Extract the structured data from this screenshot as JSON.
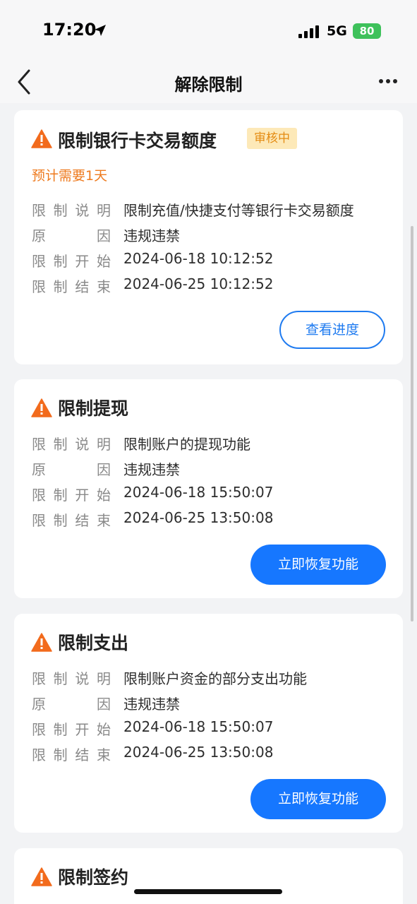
{
  "status": {
    "time": "17:20",
    "network": "5G",
    "battery": "80"
  },
  "nav": {
    "title": "解除限制"
  },
  "cards": [
    {
      "title": "限制银行卡交易额度",
      "badge": "审核中",
      "eta": "预计需要1天",
      "rows": [
        {
          "label": [
            "限",
            "制",
            "说",
            "明"
          ],
          "value": "限制充值/快捷支付等银行卡交易额度"
        },
        {
          "label": [
            "原",
            "因"
          ],
          "value": "违规违禁"
        },
        {
          "label": [
            "限",
            "制",
            "开",
            "始"
          ],
          "value": "2024-06-18 10:12:52"
        },
        {
          "label": [
            "限",
            "制",
            "结",
            "束"
          ],
          "value": "2024-06-25 10:12:52"
        }
      ],
      "button": "查看进度"
    },
    {
      "title": "限制提现",
      "rows": [
        {
          "label": [
            "限",
            "制",
            "说",
            "明"
          ],
          "value": "限制账户的提现功能"
        },
        {
          "label": [
            "原",
            "因"
          ],
          "value": "违规违禁"
        },
        {
          "label": [
            "限",
            "制",
            "开",
            "始"
          ],
          "value": "2024-06-18 15:50:07"
        },
        {
          "label": [
            "限",
            "制",
            "结",
            "束"
          ],
          "value": "2024-06-25 13:50:08"
        }
      ],
      "button": "立即恢复功能"
    },
    {
      "title": "限制支出",
      "rows": [
        {
          "label": [
            "限",
            "制",
            "说",
            "明"
          ],
          "value": "限制账户资金的部分支出功能"
        },
        {
          "label": [
            "原",
            "因"
          ],
          "value": "违规违禁"
        },
        {
          "label": [
            "限",
            "制",
            "开",
            "始"
          ],
          "value": "2024-06-18 15:50:07"
        },
        {
          "label": [
            "限",
            "制",
            "结",
            "束"
          ],
          "value": "2024-06-25 13:50:08"
        }
      ],
      "button": "立即恢复功能"
    },
    {
      "title": "限制签约"
    }
  ],
  "colors": {
    "primary": "#1677ff",
    "warning": "#f26b1d",
    "badge_bg": "#fde9b8",
    "badge_text": "#e48b12"
  }
}
